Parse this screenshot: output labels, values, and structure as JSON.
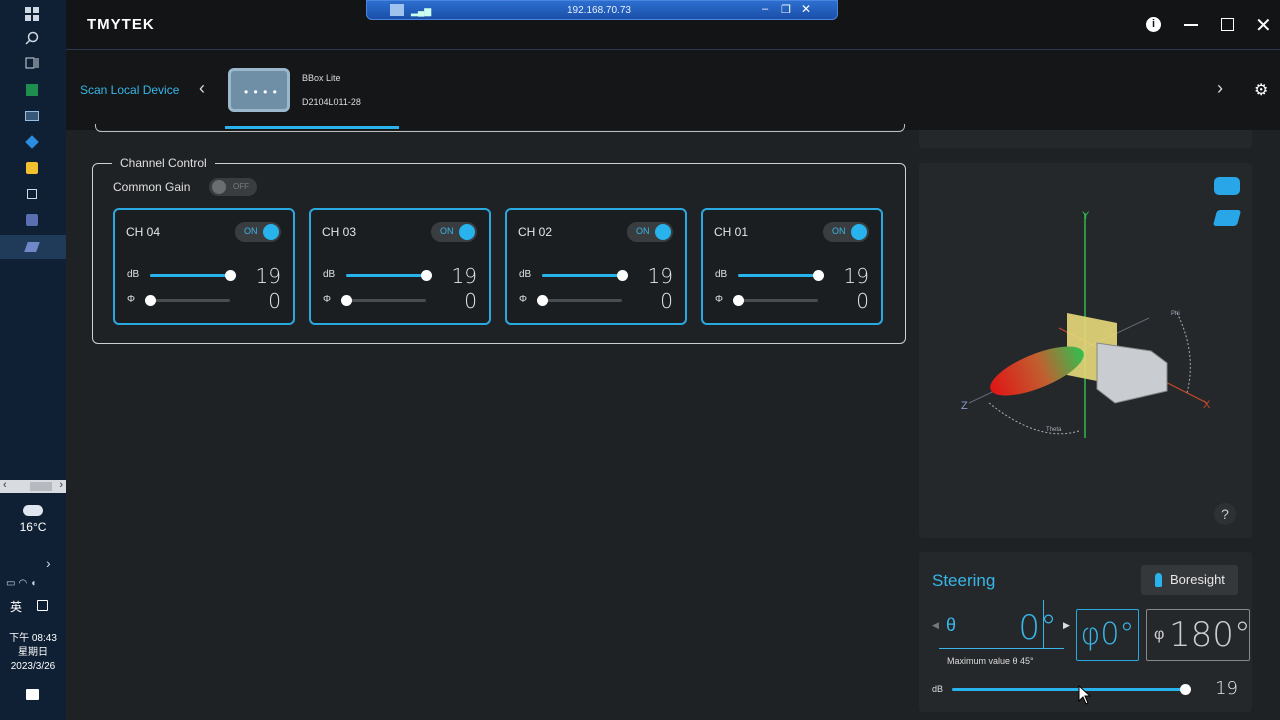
{
  "remote": {
    "ip": "192.168.70.73"
  },
  "app": {
    "brand": "TMYTEK"
  },
  "device_bar": {
    "scan_label": "Scan Local Device",
    "device_name": "BBox Lite",
    "device_serial": "D2104L011-28"
  },
  "channel_control": {
    "title": "Channel Control",
    "common_gain_label": "Common Gain",
    "common_gain_state": "OFF",
    "channels": [
      {
        "name": "CH 04",
        "state": "ON",
        "db_label": "dB",
        "db_value": "19",
        "db_level": 1.0,
        "phase_label": "Φ",
        "phase_value": "0",
        "phase_level": 0.0
      },
      {
        "name": "CH 03",
        "state": "ON",
        "db_label": "dB",
        "db_value": "19",
        "db_level": 1.0,
        "phase_label": "Φ",
        "phase_value": "0",
        "phase_level": 0.0
      },
      {
        "name": "CH 02",
        "state": "ON",
        "db_label": "dB",
        "db_value": "19",
        "db_level": 1.0,
        "phase_label": "Φ",
        "phase_value": "0",
        "phase_level": 0.0
      },
      {
        "name": "CH 01",
        "state": "ON",
        "db_label": "dB",
        "db_value": "19",
        "db_level": 1.0,
        "phase_label": "Φ",
        "phase_value": "0",
        "phase_level": 0.0
      }
    ]
  },
  "pattern_view": {
    "axis_y": "Y",
    "axis_x": "X",
    "axis_z": "Z",
    "phi_label": "Phi",
    "theta_label": "Theta",
    "help": "?"
  },
  "steering": {
    "title": "Steering",
    "boresight_label": "Boresight",
    "theta_symbol": "θ",
    "theta_value": "0°",
    "phi_box": "φ0°",
    "phi_symbol": "φ",
    "phi_value": "180°",
    "max_note": "Maximum value θ 45°",
    "db_label": "dB",
    "db_value": "19",
    "db_level": 1.0
  },
  "system": {
    "weather_temp": "16°C",
    "ime": "英",
    "time": "下午 08:43",
    "weekday": "星期日",
    "date": "2023/3/26"
  },
  "colors": {
    "accent": "#29b3ec",
    "card_border": "#29a9e0"
  }
}
